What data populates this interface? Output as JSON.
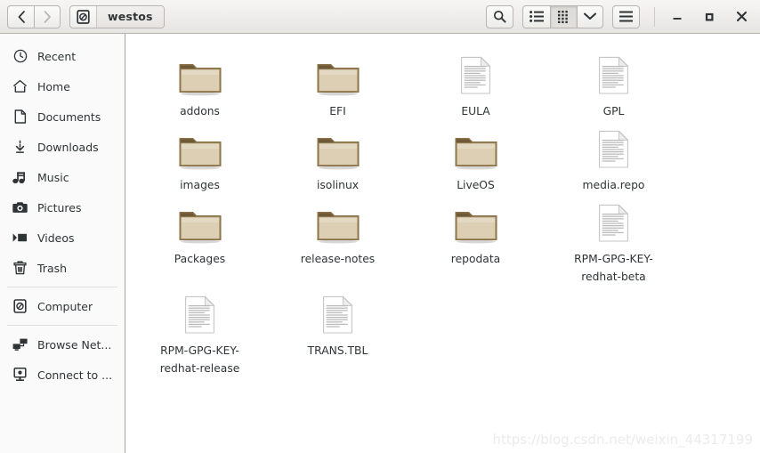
{
  "window": {
    "title": "westos",
    "nav": {
      "back": "‹",
      "forward": "›",
      "back_name": "Back",
      "forward_name": "Forward"
    },
    "path_icon": "disc-icon",
    "controls": {
      "minimize": "Minimize",
      "maximize": "Maximize",
      "close": "Close"
    },
    "toolbar": [
      {
        "name": "search-button",
        "icon": "search-icon",
        "active": false
      },
      {
        "name": "list-view-button",
        "icon": "list-view-icon",
        "active": false
      },
      {
        "name": "grid-view-button",
        "icon": "grid-view-icon",
        "active": true
      },
      {
        "name": "view-options-button",
        "icon": "chevron-down-icon",
        "active": false
      },
      {
        "name": "menu-button",
        "icon": "hamburger-menu-icon",
        "active": false
      }
    ]
  },
  "sidebar": {
    "items": [
      {
        "label": "Recent",
        "icon": "clock-icon",
        "sep_after": false
      },
      {
        "label": "Home",
        "icon": "home-icon",
        "sep_after": false
      },
      {
        "label": "Documents",
        "icon": "document-icon",
        "sep_after": false
      },
      {
        "label": "Downloads",
        "icon": "download-icon",
        "sep_after": false
      },
      {
        "label": "Music",
        "icon": "music-icon",
        "sep_after": false
      },
      {
        "label": "Pictures",
        "icon": "camera-icon",
        "sep_after": false
      },
      {
        "label": "Videos",
        "icon": "video-icon",
        "sep_after": false
      },
      {
        "label": "Trash",
        "icon": "trash-icon",
        "sep_after": true
      },
      {
        "label": "Computer",
        "icon": "disc-icon",
        "sep_after": true
      },
      {
        "label": "Browse Net...",
        "icon": "network-icon",
        "sep_after": false
      },
      {
        "label": "Connect to ...",
        "icon": "server-icon",
        "sep_after": false
      }
    ]
  },
  "files": [
    {
      "name": "addons",
      "type": "folder"
    },
    {
      "name": "EFI",
      "type": "folder"
    },
    {
      "name": "EULA",
      "type": "file"
    },
    {
      "name": "GPL",
      "type": "file"
    },
    {
      "name": "images",
      "type": "folder"
    },
    {
      "name": "isolinux",
      "type": "folder"
    },
    {
      "name": "LiveOS",
      "type": "folder"
    },
    {
      "name": "media.repo",
      "type": "file"
    },
    {
      "name": "Packages",
      "type": "folder"
    },
    {
      "name": "release-notes",
      "type": "folder"
    },
    {
      "name": "repodata",
      "type": "folder"
    },
    {
      "name": "RPM-GPG-KEY-redhat-beta",
      "type": "file"
    },
    {
      "name": "RPM-GPG-KEY-redhat-release",
      "type": "file"
    },
    {
      "name": "TRANS.TBL",
      "type": "file"
    }
  ],
  "watermark": "https://blog.csdn.net/weixin_44317199",
  "colors": {
    "folder_body": "#dccfb4",
    "folder_tab": "#8a7047",
    "header_bg": "#eeecea",
    "sidebar_bg": "#fafafa",
    "text": "#2e3436"
  }
}
